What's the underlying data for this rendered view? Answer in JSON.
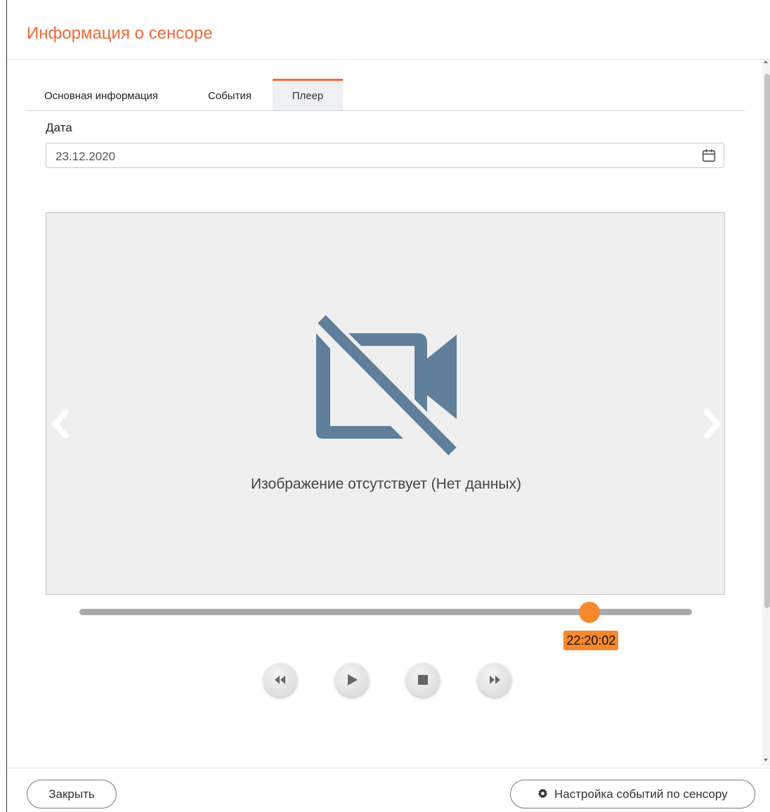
{
  "dialog": {
    "title": "Информация о сенсоре"
  },
  "tabs": [
    {
      "label": "Основная информация",
      "active": false
    },
    {
      "label": "События",
      "active": false
    },
    {
      "label": "Плеер",
      "active": true
    }
  ],
  "date_field": {
    "label": "Дата",
    "value": "23.12.2020",
    "icon": "calendar-icon"
  },
  "viewer": {
    "message": "Изображение отсутствует (Нет данных)",
    "icon": "video-off-icon"
  },
  "timeline": {
    "position_fraction": 0.833,
    "time": "22:20:02"
  },
  "player_controls": {
    "icons": [
      "rewind-icon",
      "play-icon",
      "stop-icon",
      "fast-forward-icon"
    ]
  },
  "footer": {
    "close_label": "Закрыть",
    "settings_label": "Настройка событий по сенсору",
    "settings_icon": "gear-icon"
  },
  "colors": {
    "accent": "#ee6b3b",
    "slider_thumb": "#f7882b",
    "icon_slate": "#5f7f9b"
  }
}
